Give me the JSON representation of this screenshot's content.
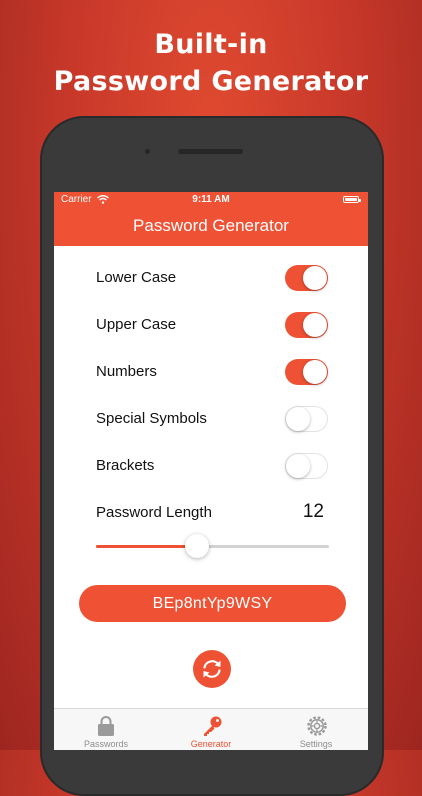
{
  "headline": {
    "line1": "Built-in",
    "line2": "Password Generator"
  },
  "status_bar": {
    "carrier": "Carrier",
    "time": "9:11 AM",
    "icons": [
      "wifi-icon",
      "battery-icon"
    ]
  },
  "nav": {
    "title": "Password Generator"
  },
  "options": [
    {
      "label": "Lower Case",
      "enabled": true
    },
    {
      "label": "Upper Case",
      "enabled": true
    },
    {
      "label": "Numbers",
      "enabled": true
    },
    {
      "label": "Special Symbols",
      "enabled": false
    },
    {
      "label": "Brackets",
      "enabled": false
    }
  ],
  "length": {
    "label": "Password Length",
    "value": "12",
    "slider_fraction": 0.435
  },
  "password": {
    "value": "BEp8ntYp9WSY"
  },
  "refresh": {
    "icon": "refresh-icon"
  },
  "tabs": [
    {
      "label": "Passwords",
      "icon": "lock-icon",
      "active": false
    },
    {
      "label": "Generator",
      "icon": "key-icon",
      "active": true
    },
    {
      "label": "Settings",
      "icon": "gear-icon",
      "active": false
    }
  ],
  "colors": {
    "accent": "#ee5133",
    "background": "#c9392a",
    "inactive": "#8e8e8e"
  }
}
